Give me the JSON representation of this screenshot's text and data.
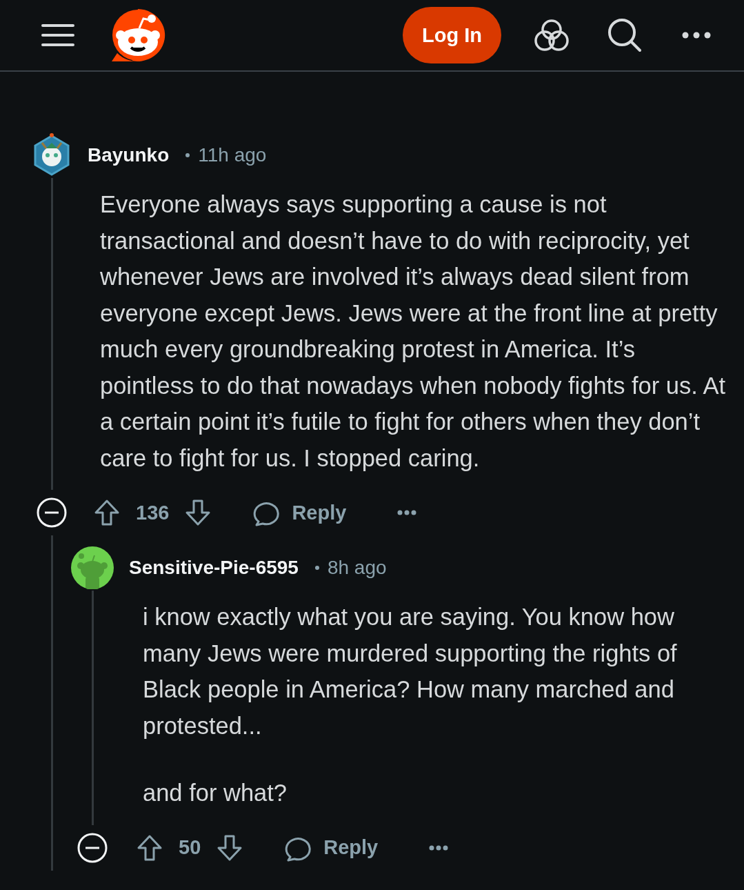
{
  "header": {
    "login_label": "Log In"
  },
  "comments": [
    {
      "author": "Bayunko",
      "time": "11h ago",
      "kind": "hexagon",
      "paragraphs": [
        "Everyone always says supporting a cause is not transactional and doesn’t have to do with reciprocity, yet whenever Jews are involved it’s always dead silent from everyone except Jews. Jews were at the front line at pretty much every groundbreaking protest in America. It’s pointless to do that nowadays when nobody fights for us. At a certain point it’s futile to fight for others when they don’t care to fight for us. I stopped caring."
      ],
      "score": "136",
      "reply_label": "Reply",
      "expanded": true,
      "children": [
        {
          "author": "Sensitive-Pie-6595",
          "time": "8h ago",
          "kind": "circle",
          "paragraphs": [
            "i know exactly what you are saying. You know how many Jews were murdered supporting the rights of Black people in America? How many marched and protested...",
            "and for what?"
          ],
          "score": "50",
          "reply_label": "Reply",
          "expanded": true
        }
      ]
    }
  ]
}
